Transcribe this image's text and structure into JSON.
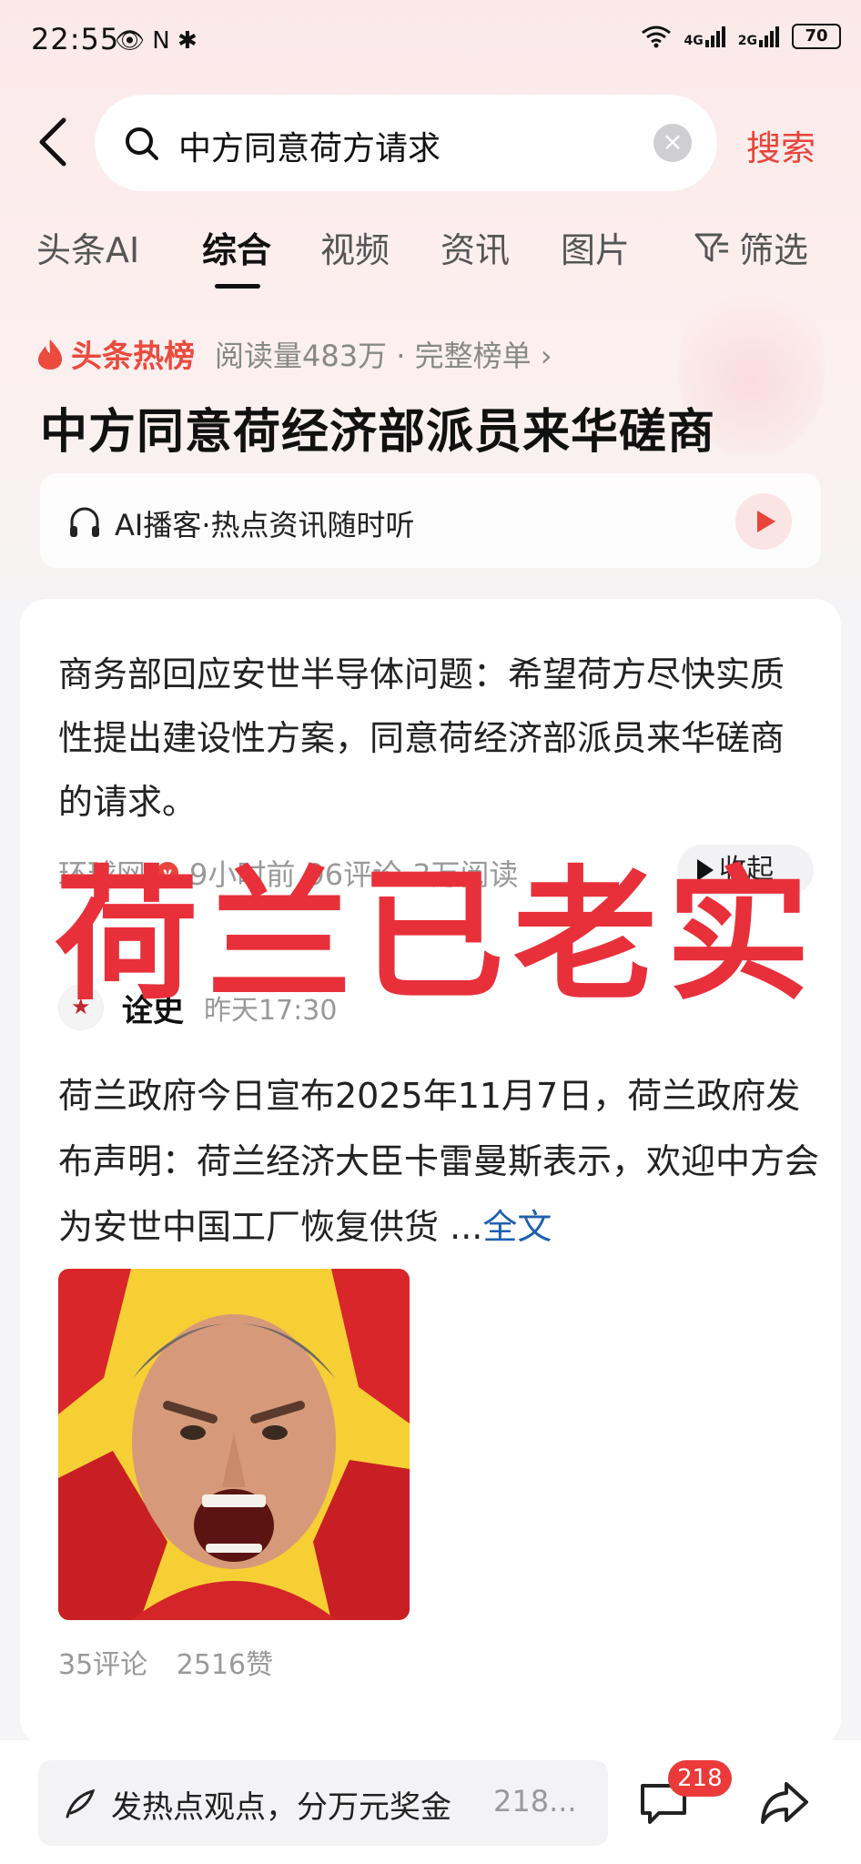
{
  "status_bar": {
    "time": "22:55",
    "left_icons": "👁 N ✱",
    "signal_1": "4G",
    "signal_2": "2G",
    "battery": "70"
  },
  "search": {
    "query": "中方同意荷方请求",
    "button": "搜索"
  },
  "tabs": [
    {
      "label": "头条AI",
      "active": false
    },
    {
      "label": "综合",
      "active": true
    },
    {
      "label": "视频",
      "active": false
    },
    {
      "label": "资讯",
      "active": false
    },
    {
      "label": "图片",
      "active": false
    }
  ],
  "filter_label": "筛选",
  "hot": {
    "brand": "头条热榜",
    "meta": "阅读量483万 · 完整榜单 ›",
    "headline": "中方同意荷经济部派员来华磋商"
  },
  "podcast": {
    "text": "AI播客·热点资讯随时听"
  },
  "card": {
    "summary": "商务部回应安世半导体问题：希望荷方尽快实质性提出建设性方案，同意荷经济部派员来华磋商的请求。",
    "source": "环球网",
    "time_ago": "9小时前",
    "comments": "96评论",
    "reads": "3万阅读",
    "collapse_label": "收起",
    "author": "诠史",
    "author_time": "昨天17:30",
    "body": "荷兰政府今日宣布2025年11月7日，荷兰政府发布声明：荷兰经济大臣卡雷曼斯表示，欢迎中方会为安世中国工厂恢复供货",
    "ellipsis": "...",
    "full_text_link": "全文",
    "stat_comments": "35评论",
    "stat_likes": "2516赞"
  },
  "overlay": "荷兰已老实",
  "bottom": {
    "input_text": "发热点观点，分万元奖金",
    "input_count": "218...",
    "badge": "218"
  },
  "colors": {
    "accent": "#e8443a",
    "link": "#1f5fb0",
    "overlay": "#e8303a"
  }
}
